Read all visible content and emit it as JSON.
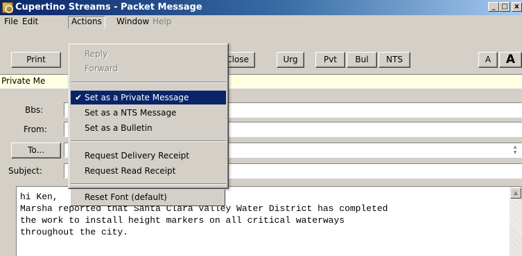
{
  "window": {
    "title": "Cupertino Streams - Packet Message",
    "min_glyph": "_",
    "max_glyph": "□",
    "close_glyph": "x"
  },
  "menubar": {
    "file": "File",
    "edit": "Edit",
    "actions": "Actions",
    "window": "Window",
    "help": "Help"
  },
  "toolbar": {
    "print": "Print",
    "close": "Close",
    "urg": "Urg",
    "pvt": "Pvt",
    "bul": "Bul",
    "nts": "NTS",
    "font_small": "A",
    "font_large": "A"
  },
  "banner": {
    "text": "Private Me"
  },
  "fields": {
    "bbs_label": "Bbs:",
    "bbs_value": "",
    "from_label": "From:",
    "from_value": "",
    "to_button": "To...",
    "to_value": "",
    "subject_label": "Subject:",
    "subject_value": ""
  },
  "message": {
    "body": "hi Ken,\nMarsha reported that Santa Clara Valley Water District has completed\nthe work to install height markers on all critical waterways\nthroughout the city."
  },
  "actions_menu": {
    "reply": "Reply",
    "forward": "Forward",
    "set_private": "Set as a Private Message",
    "set_nts": "Set as a NTS Message",
    "set_bulletin": "Set as a Bulletin",
    "delivery_receipt": "Request Delivery Receipt",
    "read_receipt": "Request Read Receipt",
    "reset_font": "Reset Font (default)",
    "check_glyph": "✔"
  }
}
